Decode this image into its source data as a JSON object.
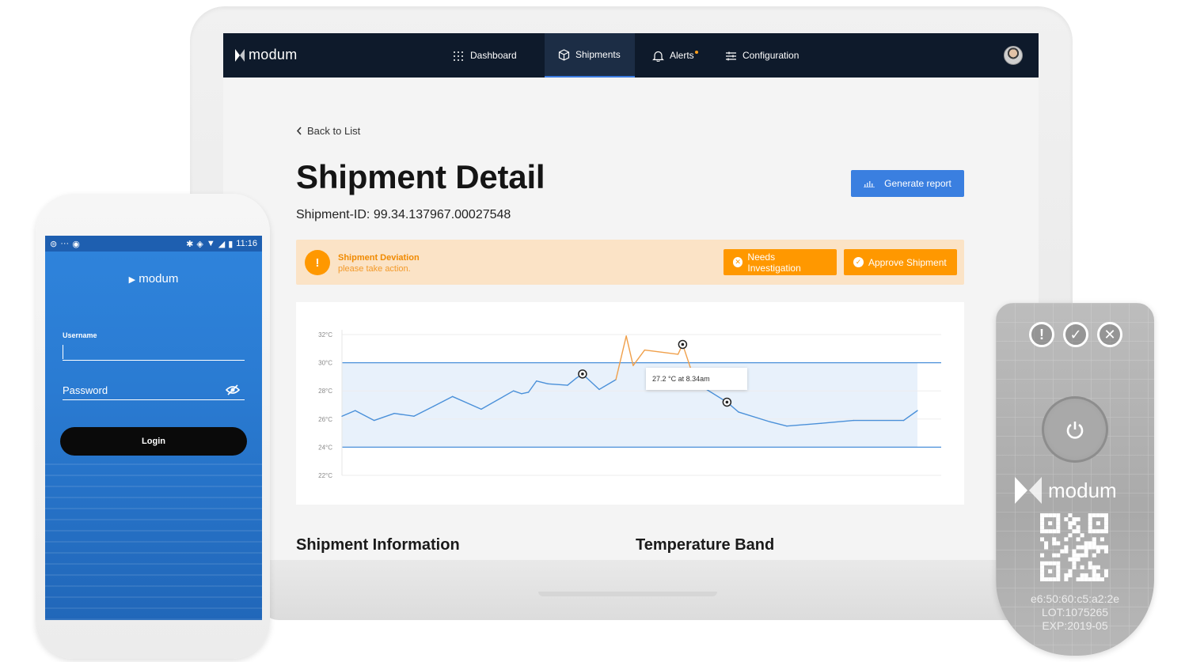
{
  "app": {
    "logo_text": "modum",
    "nav": [
      {
        "label": "Dashboard",
        "icon": "grid-icon"
      },
      {
        "label": "Shipments",
        "icon": "box-icon",
        "active": true
      },
      {
        "label": "Alerts",
        "icon": "bell-icon"
      },
      {
        "label": "Configuration",
        "icon": "sliders-icon"
      }
    ],
    "back_label": "Back to List",
    "title": "Shipment Detail",
    "shipment_id": "Shipment-ID: 99.34.137967.00027548",
    "report_button": "Generate report",
    "deviation": {
      "title": "Shipment Deviation",
      "subtitle": "please take action.",
      "needs_investigation": "Needs Investigation",
      "approve": "Approve Shipment"
    },
    "tooltip": "27.2 °C at 8.34am",
    "sections": [
      "Shipment Information",
      "Temperature Band"
    ]
  },
  "chart_data": {
    "type": "line",
    "title": "",
    "xlabel": "",
    "ylabel": "",
    "y_ticks": [
      "32°C",
      "30°C",
      "28°C",
      "26°C",
      "24°C",
      "22°C"
    ],
    "ylim": [
      22,
      32
    ],
    "band": {
      "low": 24,
      "high": 30
    },
    "series": [
      {
        "x": [
          0,
          2.3,
          5.6,
          9.1,
          12.5,
          15.9,
          19.2,
          24.2,
          29.8,
          31.2,
          32.4,
          33.8,
          35.8,
          39.2,
          40.7,
          41.8,
          44.7,
          47.6,
          49.4,
          50.6,
          52.6,
          58.4,
          59.2,
          61.4,
          66.9,
          68.9,
          74.4,
          77.3,
          83.3,
          88.9,
          97.6,
          100
        ],
        "y": [
          26.2,
          26.6,
          25.9,
          26.4,
          26.2,
          26.9,
          27.6,
          26.7,
          28,
          27.8,
          27.9,
          28.7,
          28.5,
          28.4,
          28.9,
          29.2,
          28.1,
          28.8,
          31.9,
          29.8,
          30.9,
          30.6,
          31.3,
          28.6,
          27.2,
          26.5,
          25.8,
          25.5,
          25.7,
          25.9,
          25.9,
          26.6
        ]
      }
    ],
    "highlighted_points": [
      15,
      22,
      24
    ],
    "deviation_color": "#f0a04b",
    "line_color": "#4a90d9",
    "band_color": "#e8f1fb"
  },
  "phone": {
    "status_time": "11:16",
    "logo_text": "modum",
    "username_label": "Username",
    "password_label": "Password",
    "login_button": "Login"
  },
  "device": {
    "logo_text": "modum",
    "mac": "e6:50:60:c5:a2:2e",
    "lot": "LOT:1075265",
    "exp": "EXP:2019-05"
  },
  "colors": {
    "nav_bg": "#0e1a2b",
    "accent_blue": "#3a7fe0",
    "warning_orange": "#ff9800",
    "warning_bg": "#fbe3c6",
    "phone_blue": "#2f84dc"
  }
}
